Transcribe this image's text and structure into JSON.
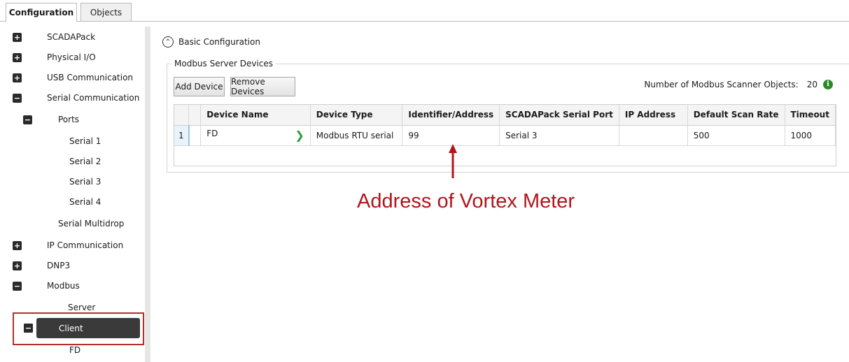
{
  "tabs": {
    "configuration": "Configuration",
    "objects": "Objects"
  },
  "tree": {
    "scadapack": "SCADAPack",
    "physical_io": "Physical I/O",
    "usb": "USB Communication",
    "serial_comm": "Serial Communication",
    "ports": "Ports",
    "serial1": "Serial 1",
    "serial2": "Serial 2",
    "serial3": "Serial 3",
    "serial4": "Serial 4",
    "serial_multidrop": "Serial Multidrop",
    "ip_comm": "IP Communication",
    "dnp3": "DNP3",
    "modbus": "Modbus",
    "server": "Server",
    "client": "Client",
    "fd": "FD",
    "expand_symbol": "+",
    "collapse_symbol": "−"
  },
  "main": {
    "basic_config": "Basic Configuration",
    "group_title": "Modbus Server Devices",
    "add_device": "Add Device",
    "remove_devices": "Remove Devices",
    "scanner_label": "Number of Modbus Scanner Objects:",
    "scanner_count": "20",
    "info_glyph": "i",
    "collapse_glyph": "⌃"
  },
  "table": {
    "headers": {
      "device_name": "Device Name",
      "device_type": "Device Type",
      "identifier": "Identifier/Address",
      "serial_port": "SCADAPack Serial Port",
      "ip_address": "IP Address",
      "scan_rate": "Default Scan Rate",
      "timeout": "Timeout"
    },
    "rows": [
      {
        "num": "1",
        "device_name": "FD",
        "device_type": "Modbus RTU serial",
        "identifier": "99",
        "serial_port": "Serial 3",
        "ip_address": "",
        "scan_rate": "500",
        "timeout": "1000"
      }
    ]
  },
  "annotation": "Address of Vortex Meter",
  "colors": {
    "annotation": "#b0161b",
    "highlight_box": "#b03030",
    "selected_item": "#3a3a3a",
    "chevron": "#2b9a3a",
    "info": "#2a8a2a"
  }
}
